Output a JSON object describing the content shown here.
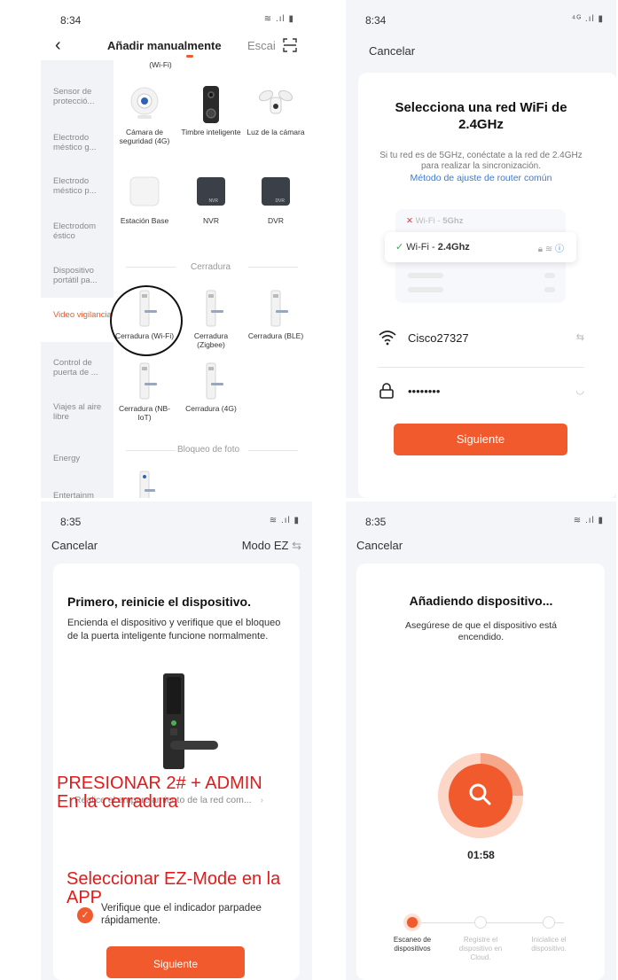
{
  "panel1": {
    "time": "8:34",
    "title": "Añadir manualmente",
    "scan_label": "Escai",
    "top_partial_label": "(Wi-Fi)",
    "sidebar": [
      "Sensor de protecció...",
      "Electrodo méstico g...",
      "Electrodo méstico p...",
      "Electrodom éstico",
      "Dispositivo portátil pa...",
      "Video vigilancia",
      "Control de puerta de ...",
      "Viajes al aire libre",
      "Energy",
      "Entertainm"
    ],
    "devices_row1": [
      "Cámara de seguridad (4G)",
      "Timbre inteligente",
      "Luz de la cámara"
    ],
    "devices_row2": [
      "Estación Base",
      "NVR",
      "DVR"
    ],
    "section_lock": "Cerradura",
    "locks_row1": [
      "Cerradura (Wi-Fi)",
      "Cerradura (Zigbee)",
      "Cerradura (BLE)"
    ],
    "locks_row2": [
      "Cerradura (NB-IoT)",
      "Cerradura (4G)"
    ],
    "section_photo": "Bloqueo de foto",
    "nvr_badge": "NVR",
    "dvr_badge": "DVR"
  },
  "panel2": {
    "time": "8:34",
    "cancel": "Cancelar",
    "title": "Selecciona una red WiFi de 2.4GHz",
    "description": "Si tu red es de 5GHz, conéctate a la red de 2.4GHz para realizar la sincronización.",
    "link": "Método de ajuste de router común",
    "wifi_5g_prefix": "Wi-Fi - ",
    "wifi_5g": "5Ghz",
    "wifi_24_prefix": "Wi-Fi - ",
    "wifi_24": "2.4Ghz",
    "ssid": "Cisco27327",
    "password": "••••••••",
    "next": "Siguiente"
  },
  "panel3": {
    "time": "8:35",
    "cancel": "Cancelar",
    "mode": "Modo EZ",
    "title": "Primero, reinicie el dispositivo.",
    "description": "Encienda el dispositivo y verifique que el bloqueo de la puerta inteligente funcione normalmente.",
    "pair_link": "Realice el emparejamiento de la red com...",
    "overlay1_line1": "PRESIONAR 2# + ADMIN",
    "overlay1_line2": "En la cerradura",
    "overlay2": "Seleccionar EZ-Mode en la APP",
    "check_text": "Verifique que el indicador parpadee rápidamente.",
    "next": "Siguiente"
  },
  "panel4": {
    "time": "8:35",
    "cancel": "Cancelar",
    "title": "Añadiendo dispositivo...",
    "description": "Asegúrese de que el dispositivo está encendido.",
    "timer": "01:58",
    "steps": [
      "Escaneo de dispositivos",
      "Registre el dispositivo en Cloud.",
      "Inicialice el dispositivo."
    ]
  },
  "colors": {
    "accent": "#f05a2d",
    "link": "#3a7bd5",
    "annotation": "#e01b1b"
  }
}
